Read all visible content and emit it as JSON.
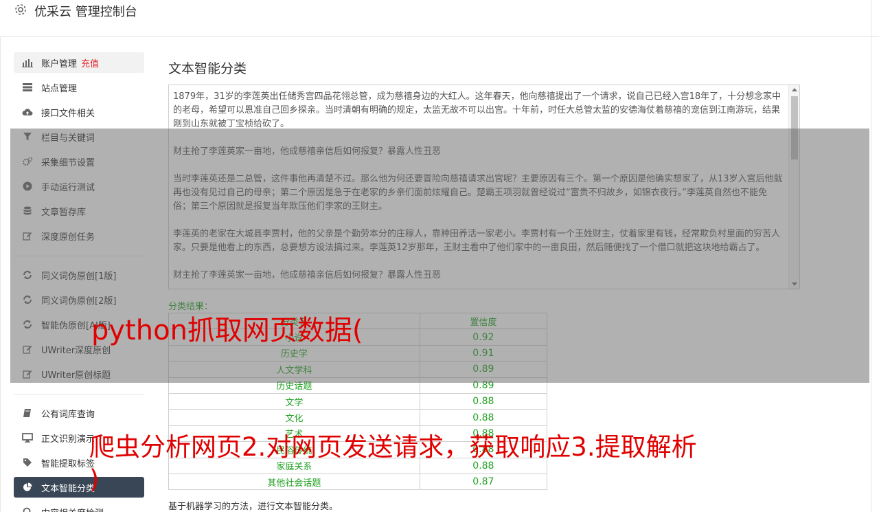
{
  "header": {
    "title": "优采云 管理控制台"
  },
  "sidebar": {
    "items": [
      {
        "label": "账户管理",
        "extra": "充值"
      },
      {
        "label": "站点管理"
      },
      {
        "label": "接口文件相关"
      },
      {
        "label": "栏目与关键词"
      },
      {
        "label": "采集细节设置"
      },
      {
        "label": "手动运行测试"
      },
      {
        "label": "文章暂存库"
      },
      {
        "label": "深度原创任务"
      },
      {
        "label": "同义词伪原创[1版]"
      },
      {
        "label": "同义词伪原创[2版]"
      },
      {
        "label": "智能伪原创[AI版]"
      },
      {
        "label": "UWriter深度原创"
      },
      {
        "label": "UWriter原创标题"
      },
      {
        "label": "公有词库查询"
      },
      {
        "label": "正文识别演示"
      },
      {
        "label": "智能提取标签"
      },
      {
        "label": "文本智能分类"
      },
      {
        "label": "内容相关度检测"
      }
    ]
  },
  "main": {
    "title": "文本智能分类",
    "textarea_paragraphs": [
      "1879年，31岁的李莲英出任储秀宫四品花翎总管，成为慈禧身边的大红人。这年春天，他向慈禧提出了一个请求，说自己已经入宫18年了，十分想念家中的老母，希望可以恩准自己回乡探亲。当时清朝有明确的规定，太监无故不可以出宫。十年前，时任大总管太监的安德海仗着慈禧的宠信到江南游玩，结果刚到山东就被丁宝桢给砍了。",
      "财主抢了李莲英家一亩地，他成慈禧亲信后如何报复？暴露人性丑恶",
      "当时李莲英还是二总管，这件事他再清楚不过。那么他为何还要冒险向慈禧请求出宫呢？主要原因有三个。第一个原因是他确实想家了，从13岁入宫后他就再也没有见过自己的母亲；第二个原因是急于在老家的乡亲们面前炫耀自己。楚霸王项羽就曾经说过“富贵不归故乡，如锦衣夜行。”李莲英自然也不能免俗；第三个原因就是报复当年欺压他们李家的王财主。",
      "李莲英的老家在大城县李贾村，他的父亲是个勤劳本分的庄稼人，靠种田养活一家老小。李贾村有一个王姓财主，仗着家里有钱，经常欺负村里面的穷苦人家。只要是他看上的东西，总要想方设法搞过来。李莲英12岁那年，王财主看中了他们家中的一亩良田，然后随便找了一个借口就把这块地给霸占了。",
      "财主抢了李莲英家一亩地，他成慈禧亲信后如何报复？暴露人性丑恶"
    ],
    "result_label": "分类结果：",
    "table": {
      "headers": [
        "分类名",
        "置信度"
      ],
      "rows": [
        [
          "小说",
          "0.92"
        ],
        [
          "历史学",
          "0.91"
        ],
        [
          "人文学科",
          "0.89"
        ],
        [
          "历史话题",
          "0.89"
        ],
        [
          "文学",
          "0.88"
        ],
        [
          "文化",
          "0.88"
        ],
        [
          "艺术",
          "0.88"
        ],
        [
          "民俗传统",
          "0.88"
        ],
        [
          "家庭关系",
          "0.88"
        ],
        [
          "其他社会话题",
          "0.87"
        ]
      ]
    },
    "description": "基于机器学习的方法，进行文本智能分类。"
  },
  "watermark": {
    "line1": "python抓取网页数据(",
    "line2": "爬虫分析网页2.对网页发送请求，获取响应3.提取解析",
    "line3": ")"
  },
  "colors": {
    "accent_green": "#21a121",
    "active_bg": "#394656",
    "red": "#e4252a"
  }
}
